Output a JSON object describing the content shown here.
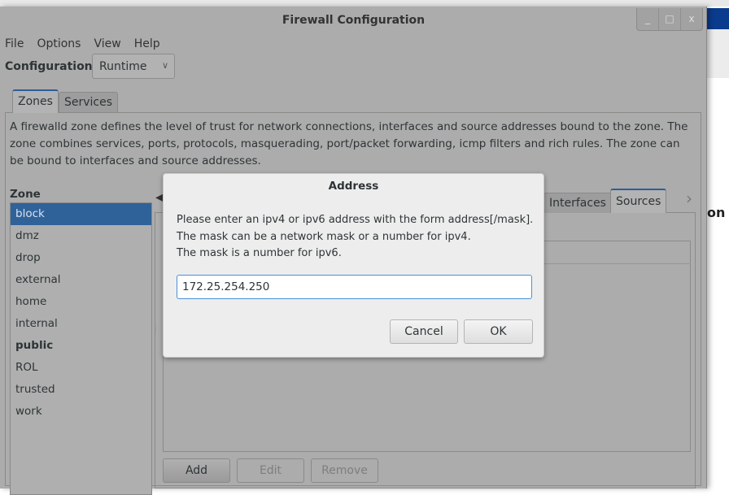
{
  "window": {
    "title": "Firewall Configuration",
    "controls": [
      "_",
      "□",
      "x"
    ]
  },
  "menu": [
    "File",
    "Options",
    "View",
    "Help"
  ],
  "configuration": {
    "label": "Configuration:",
    "value": "Runtime"
  },
  "tabs": [
    "Zones",
    "Services"
  ],
  "description": "A firewalld zone defines the level of trust for network connections, interfaces and source addresses bound to the zone. The zone combines services, ports, protocols, masquerading, port/packet forwarding, icmp filters and rich rules. The zone can be bound to interfaces and source addresses.",
  "zones": {
    "label": "Zone",
    "items": [
      "block",
      "dmz",
      "drop",
      "external",
      "home",
      "internal",
      "public",
      "ROL",
      "trusted",
      "work"
    ],
    "selected": "block",
    "default": "public"
  },
  "zone_tabs": [
    "Interfaces",
    "Sources"
  ],
  "zone_tab_active": "Sources",
  "sources_buttons": {
    "add": "Add",
    "edit": "Edit",
    "remove": "Remove"
  },
  "background_text": "on",
  "dialog": {
    "title": "Address",
    "message": [
      "Please enter an ipv4 or ipv6 address with the form address[/mask].",
      "The mask can be a network mask or a number for ipv4.",
      "The mask is a number for ipv6."
    ],
    "value": "172.25.254.250",
    "cancel": "Cancel",
    "ok": "OK"
  },
  "colors": {
    "selection": "#30629a",
    "focus": "#4a90d9",
    "dim": "#acacac"
  }
}
